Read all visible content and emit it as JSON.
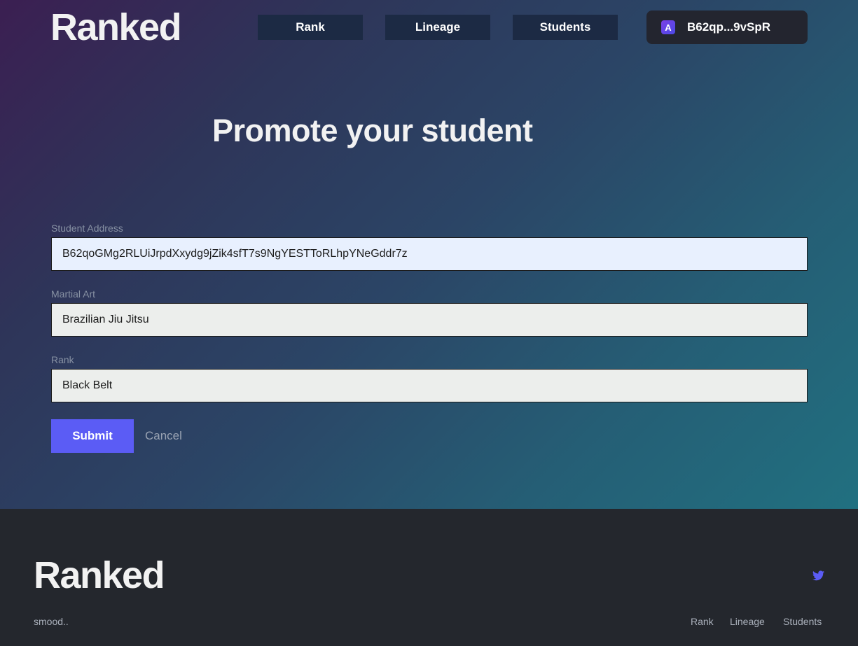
{
  "header": {
    "brand": "Ranked",
    "nav": [
      {
        "label": "Rank"
      },
      {
        "label": "Lineage"
      },
      {
        "label": "Students"
      }
    ],
    "wallet": {
      "address_short": "B62qp...9vSpR",
      "icon": "wallet-app-icon",
      "icon_glyph": "A"
    }
  },
  "main": {
    "title": "Promote your student",
    "form": {
      "student_address": {
        "label": "Student Address",
        "value": "B62qoGMg2RLUiJrpdXxydg9jZik4sfT7s9NgYESTToRLhpYNeGddr7z"
      },
      "martial_art": {
        "label": "Martial Art",
        "value": "Brazilian Jiu Jitsu"
      },
      "rank": {
        "label": "Rank",
        "value": "Black Belt"
      },
      "submit_label": "Submit",
      "cancel_label": "Cancel"
    }
  },
  "footer": {
    "brand": "Ranked",
    "tagline": "smood..",
    "social_icon": "twitter-icon",
    "links": [
      {
        "label": "Rank"
      },
      {
        "label": "Lineage"
      },
      {
        "label": "Students"
      }
    ]
  },
  "colors": {
    "accent": "#5b5cf5",
    "nav_button": "#1c2a44",
    "footer_bg": "#24272d",
    "wallet_bg": "#23252f"
  }
}
